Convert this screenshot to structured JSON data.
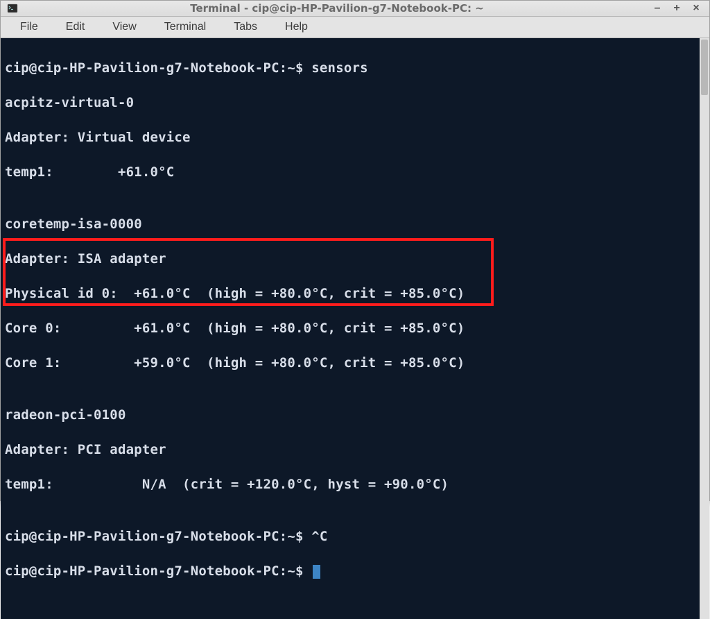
{
  "window": {
    "title": "Terminal - cip@cip-HP-Pavilion-g7-Notebook-PC: ~"
  },
  "menu": {
    "file": "File",
    "edit": "Edit",
    "view": "View",
    "terminal": "Terminal",
    "tabs": "Tabs",
    "help": "Help"
  },
  "terminal": {
    "line1": "cip@cip-HP-Pavilion-g7-Notebook-PC:~$ sensors",
    "line2": "acpitz-virtual-0",
    "line3": "Adapter: Virtual device",
    "line4": "temp1:        +61.0°C  ",
    "line5": "",
    "line6": "coretemp-isa-0000",
    "line7": "Adapter: ISA adapter",
    "line8": "Physical id 0:  +61.0°C  (high = +80.0°C, crit = +85.0°C)",
    "line9": "Core 0:         +61.0°C  (high = +80.0°C, crit = +85.0°C)",
    "line10": "Core 1:         +59.0°C  (high = +80.0°C, crit = +85.0°C)",
    "line11": "",
    "line12": "radeon-pci-0100",
    "line13": "Adapter: PCI adapter",
    "line14": "temp1:           N/A  (crit = +120.0°C, hyst = +90.0°C)",
    "line15": "",
    "line16": "cip@cip-HP-Pavilion-g7-Notebook-PC:~$ ^C",
    "line17": "cip@cip-HP-Pavilion-g7-Notebook-PC:~$ "
  }
}
